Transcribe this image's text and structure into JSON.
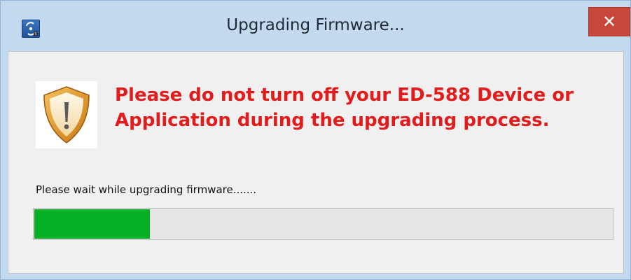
{
  "window": {
    "title": "Upgrading Firmware...",
    "close_label": "✕"
  },
  "dialog": {
    "warning_line1": "Please do not turn off your ED-588 Device or",
    "warning_line2": "Application during the upgrading process.",
    "status": "Please wait while upgrading firmware.......",
    "progress": 0.2
  },
  "colors": {
    "warning_text": "#e21b1b",
    "progress_fill": "#06b025",
    "close_button": "#c8473b"
  },
  "icons": {
    "app": "app-logo-icon",
    "warning": "warning-shield-icon",
    "close": "close-icon"
  }
}
